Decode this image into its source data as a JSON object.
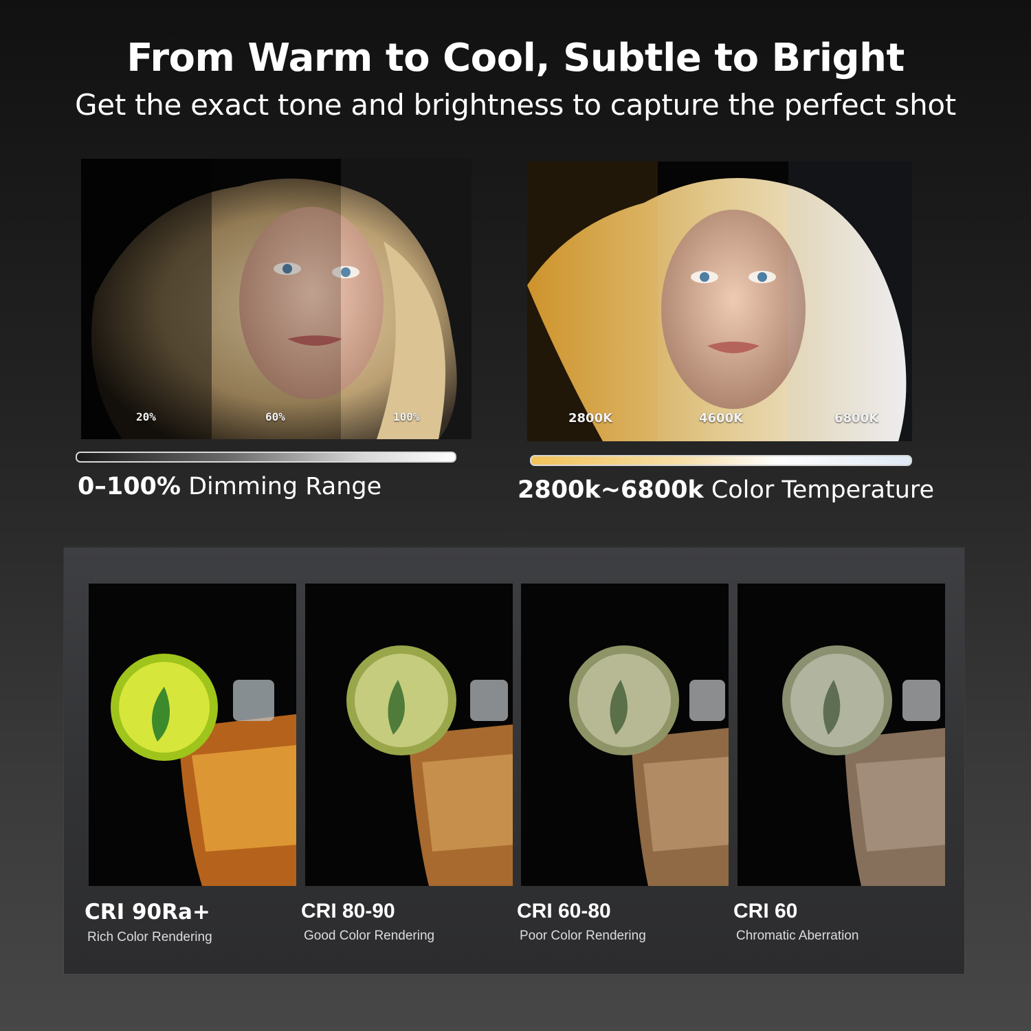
{
  "header": {
    "title": "From Warm to Cool, Subtle to Bright",
    "subtitle": "Get the exact tone and brightness to capture the perfect shot"
  },
  "dimming": {
    "levels": [
      "20%",
      "60%",
      "100%"
    ],
    "caption_strong": "0–100%",
    "caption_rest": " Dimming Range"
  },
  "temperature": {
    "levels": [
      "2800K",
      "4600K",
      "6800K"
    ],
    "caption_strong": "2800k~6800k",
    "caption_rest": " Color Temperature"
  },
  "cri": {
    "items": [
      {
        "title": "CRI 90Ra+",
        "subtitle": "Rich Color Rendering"
      },
      {
        "title": "CRI 80-90",
        "subtitle": "Good Color Rendering"
      },
      {
        "title": "CRI 60-80",
        "subtitle": "Poor Color Rendering"
      },
      {
        "title": "CRI 60",
        "subtitle": "Chromatic Aberration"
      }
    ]
  },
  "colors": {
    "background": "#1a1a1a",
    "warm_bar": "#f1c25a",
    "cool_bar": "#dfe9f5",
    "panel": "#38393b"
  }
}
